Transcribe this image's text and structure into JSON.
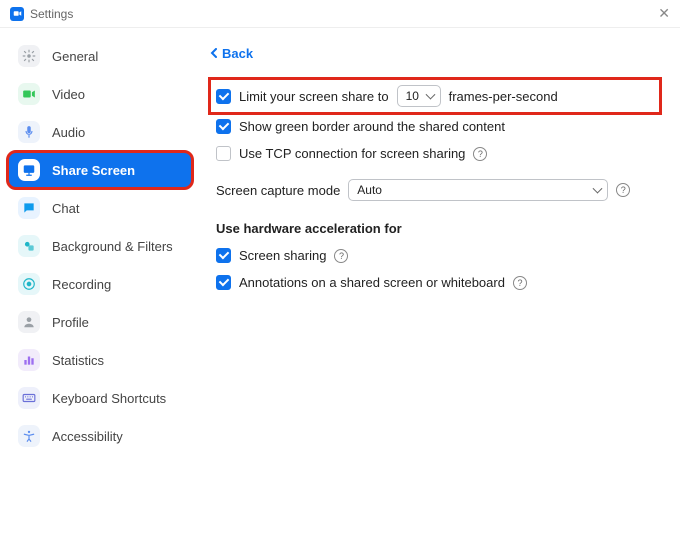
{
  "window": {
    "title": "Settings"
  },
  "sidebar": {
    "items": [
      {
        "label": "General",
        "icon_bg": "#f0f1f4",
        "icon_fg": "#9aa0a6",
        "glyph": "gear"
      },
      {
        "label": "Video",
        "icon_bg": "#e8f8ef",
        "icon_fg": "#34c759",
        "glyph": "video"
      },
      {
        "label": "Audio",
        "icon_bg": "#eef3fb",
        "icon_fg": "#5b8def",
        "glyph": "audio"
      },
      {
        "label": "Share Screen",
        "icon_bg": "#ffffff",
        "icon_fg": "#0e72ed",
        "glyph": "share",
        "active": true,
        "highlighted": true
      },
      {
        "label": "Chat",
        "icon_bg": "#e8f3ff",
        "icon_fg": "#0e9bed",
        "glyph": "chat"
      },
      {
        "label": "Background & Filters",
        "icon_bg": "#e6f7f9",
        "icon_fg": "#1fb6c8",
        "glyph": "bgfilters"
      },
      {
        "label": "Recording",
        "icon_bg": "#e6f7f9",
        "icon_fg": "#1fb6c8",
        "glyph": "recording"
      },
      {
        "label": "Profile",
        "icon_bg": "#f0f1f4",
        "icon_fg": "#9aa0a6",
        "glyph": "profile"
      },
      {
        "label": "Statistics",
        "icon_bg": "#f2ecfb",
        "icon_fg": "#9d6ff0",
        "glyph": "stats"
      },
      {
        "label": "Keyboard Shortcuts",
        "icon_bg": "#eef0fb",
        "icon_fg": "#6a6fd8",
        "glyph": "keyboard"
      },
      {
        "label": "Accessibility",
        "icon_bg": "#eef3fb",
        "icon_fg": "#5b8def",
        "glyph": "accessibility"
      }
    ]
  },
  "content": {
    "back_label": "Back",
    "fps_row": {
      "checked": true,
      "highlighted": true,
      "prefix": "Limit your screen share to",
      "value": "10",
      "suffix": "frames-per-second"
    },
    "green_border": {
      "checked": true,
      "label": "Show green border around the shared content"
    },
    "tcp": {
      "checked": false,
      "label": "Use TCP connection for screen sharing"
    },
    "capture_mode": {
      "label": "Screen capture mode",
      "value": "Auto"
    },
    "hw_accel_heading": "Use hardware acceleration for",
    "hw_screen": {
      "checked": true,
      "label": "Screen sharing"
    },
    "hw_annotations": {
      "checked": true,
      "label": "Annotations on a shared screen or whiteboard"
    }
  }
}
